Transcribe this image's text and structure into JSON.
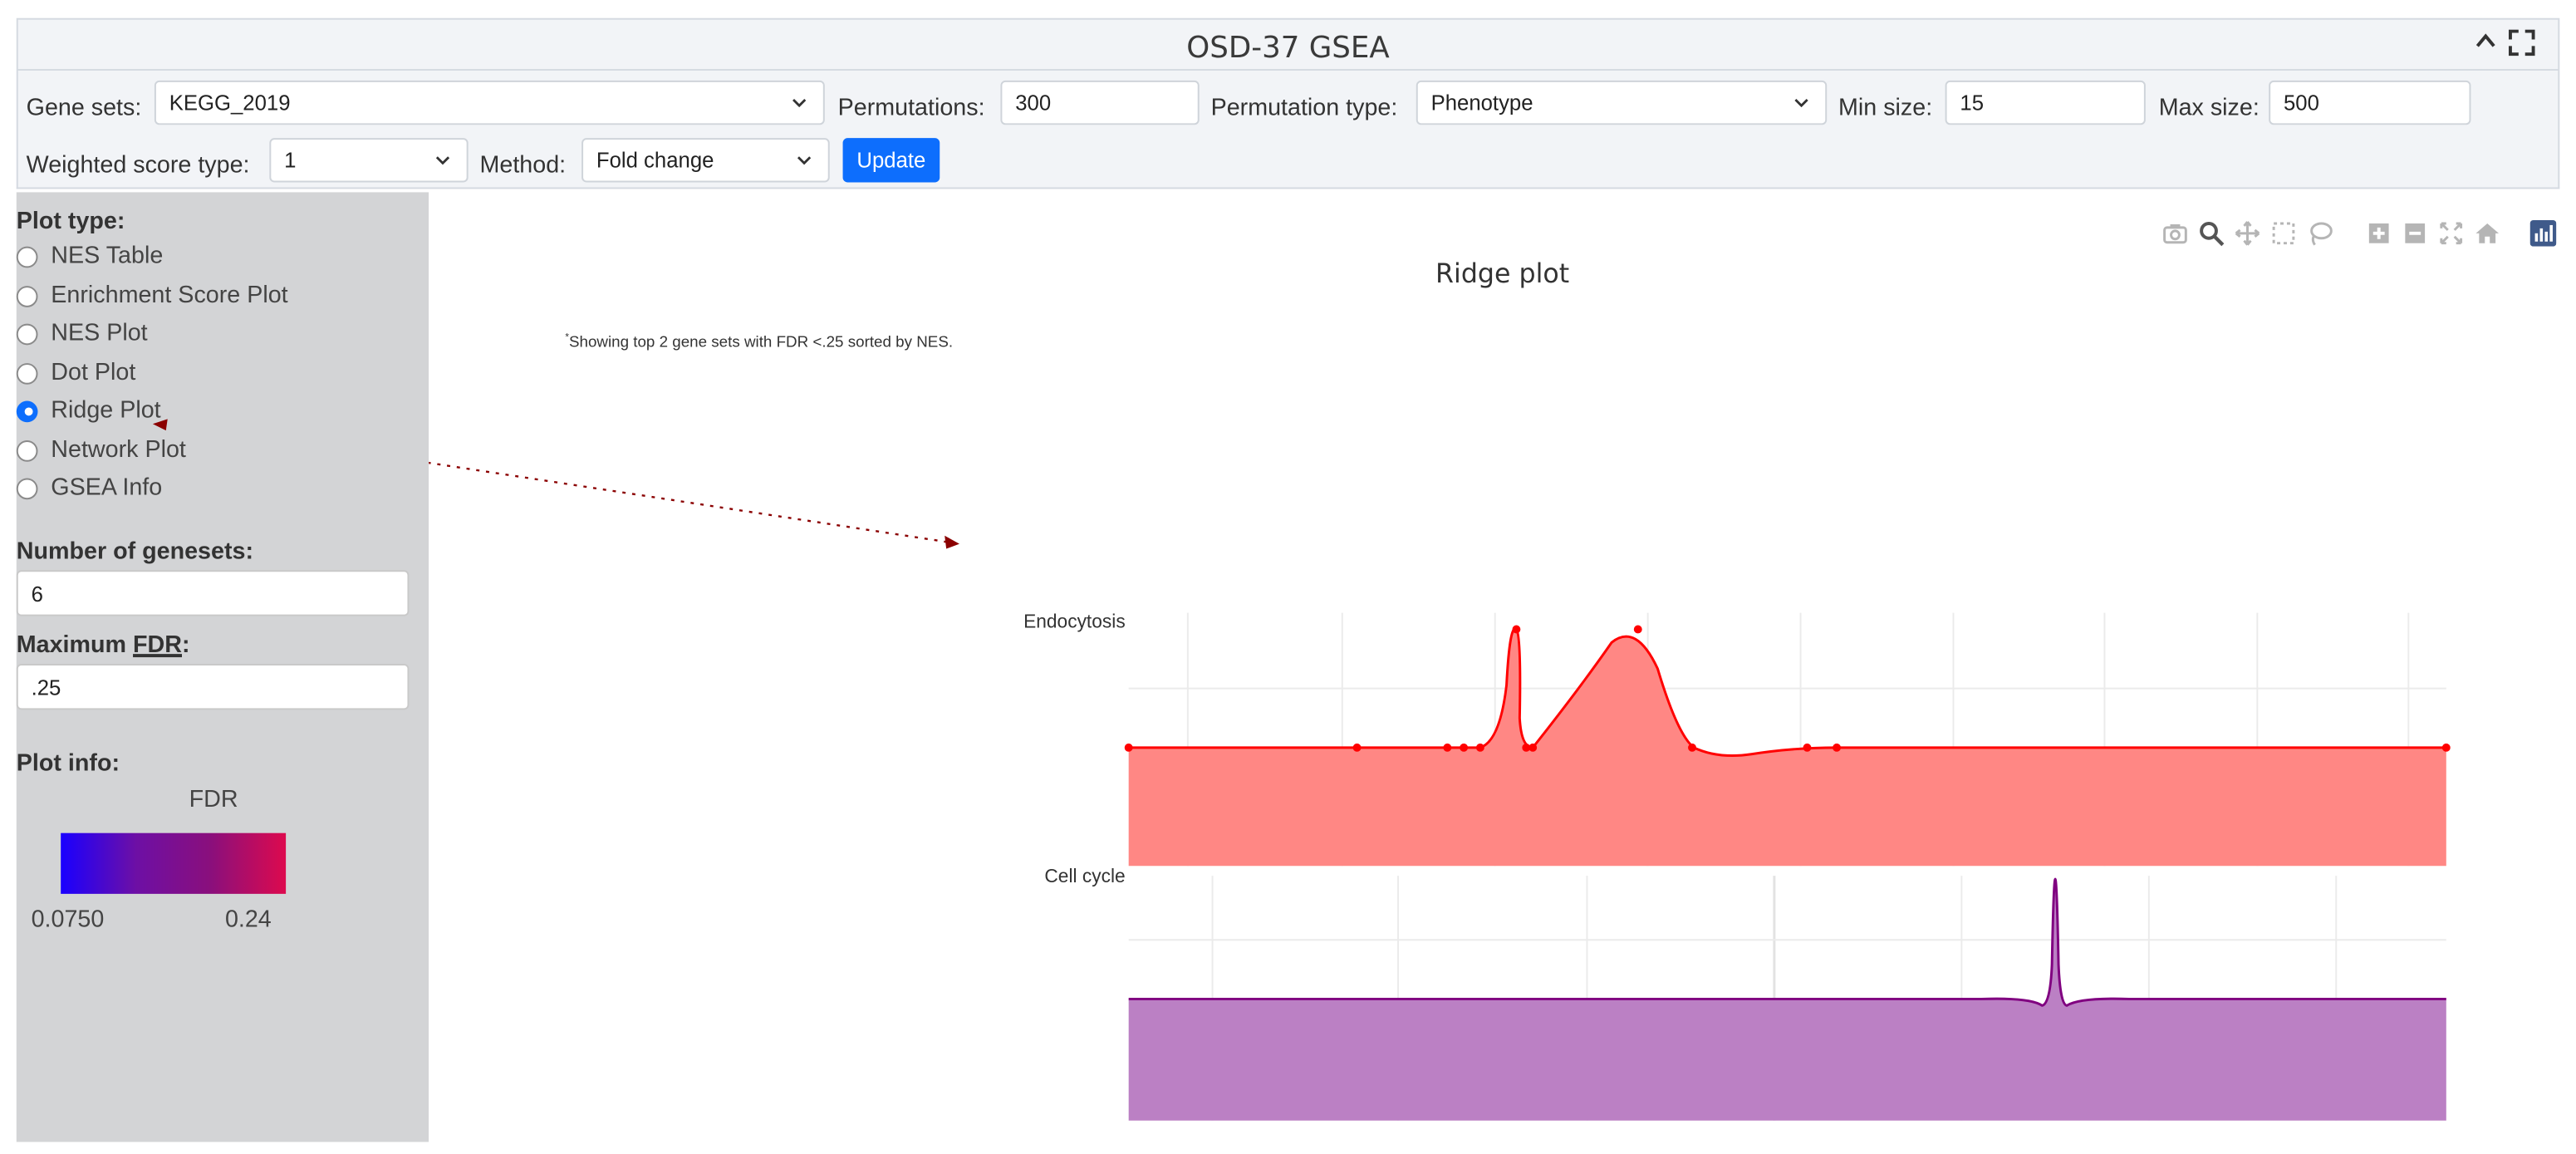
{
  "header": {
    "title": "OSD-37 GSEA"
  },
  "icons": {
    "collapse": "chevron-up-icon",
    "fullscreen": "expand-icon"
  },
  "controls": {
    "gene_sets_label": "Gene sets:",
    "gene_sets_value": "KEGG_2019",
    "permutations_label": "Permutations:",
    "permutations_value": "300",
    "permutation_type_label": "Permutation type:",
    "permutation_type_value": "Phenotype",
    "min_size_label": "Min size:",
    "min_size_value": "15",
    "max_size_label": "Max size:",
    "max_size_value": "500",
    "weighted_label": "Weighted score type:",
    "weighted_value": "1",
    "method_label": "Method:",
    "method_value": "Fold change",
    "update_label": "Update",
    "accent_color": "#0d6efd"
  },
  "sidebar": {
    "plot_type_label": "Plot type:",
    "plot_types": [
      {
        "label": "NES Table",
        "checked": false
      },
      {
        "label": "Enrichment Score Plot",
        "checked": false
      },
      {
        "label": "NES Plot",
        "checked": false
      },
      {
        "label": "Dot Plot",
        "checked": false
      },
      {
        "label": "Ridge Plot",
        "checked": true
      },
      {
        "label": "Network Plot",
        "checked": false
      },
      {
        "label": "GSEA Info",
        "checked": false
      }
    ],
    "num_genesets_label": "Number of genesets:",
    "num_genesets_value": "6",
    "max_fdr_label_prefix": "Maximum ",
    "max_fdr_label_abbr": "FDR",
    "max_fdr_label_suffix": ":",
    "max_fdr_value": ".25",
    "plot_info_label": "Plot info:",
    "legend_title": "FDR",
    "legend_min": "0.0750",
    "legend_max": "0.24",
    "legend_colors": [
      "#1a00ff",
      "#dd0a4e"
    ]
  },
  "plot": {
    "title": "Ridge plot",
    "note_marker": "*",
    "note_text": "Showing top 2 gene sets with FDR <.25 sorted by NES.",
    "modebar_icons": [
      "camera-icon",
      "zoom-icon",
      "pan-icon",
      "box-select-icon",
      "lasso-icon",
      "zoom-in-icon",
      "zoom-out-icon",
      "autoscale-icon",
      "home-icon",
      "plotly-logo-icon"
    ]
  },
  "chart_data": {
    "type": "area",
    "title": "Ridge plot",
    "series": [
      {
        "name": "Endocytosis",
        "color": "#ff0000",
        "fill": "#ff8784"
      },
      {
        "name": "Cell cycle",
        "color": "#800080",
        "fill": "#bb80c4"
      }
    ]
  }
}
